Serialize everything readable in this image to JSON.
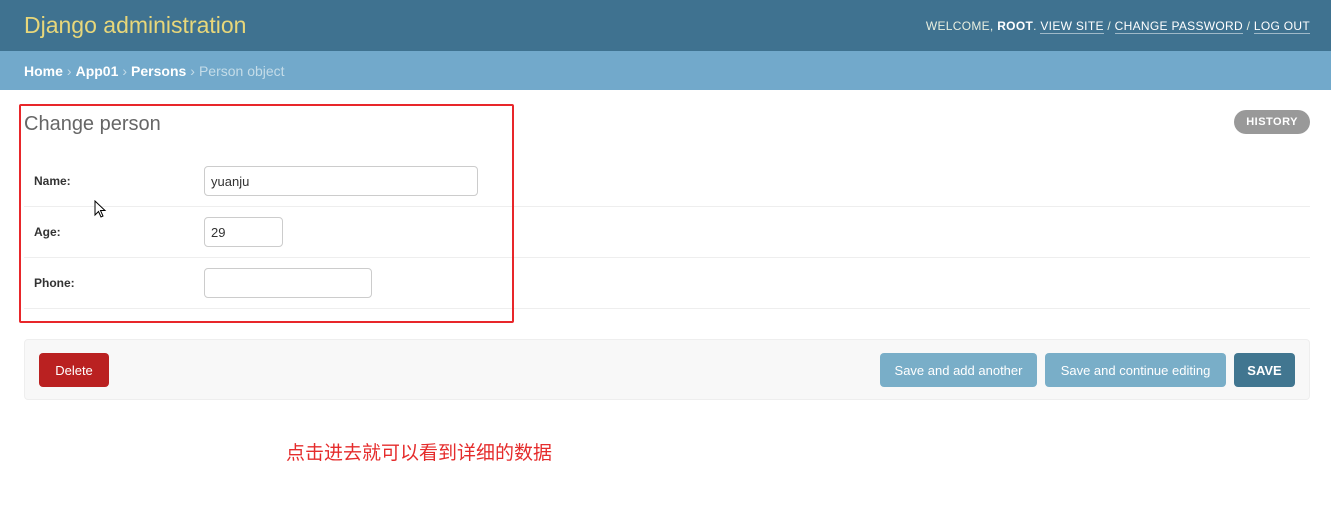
{
  "header": {
    "title": "Django administration",
    "welcome": "Welcome,",
    "user": "root",
    "view_site": "View site",
    "change_password": "Change password",
    "log_out": "Log out",
    "sep": "/"
  },
  "breadcrumbs": {
    "home": "Home",
    "app": "App01",
    "model": "Persons",
    "current": "Person object",
    "sep": "›"
  },
  "page": {
    "title": "Change person",
    "history": "HISTORY"
  },
  "form": {
    "fields": [
      {
        "label": "Name:",
        "value": "yuanju"
      },
      {
        "label": "Age:",
        "value": "29"
      },
      {
        "label": "Phone:",
        "value": ""
      }
    ]
  },
  "actions": {
    "delete": "Delete",
    "save_add": "Save and add another",
    "save_continue": "Save and continue editing",
    "save": "SAVE"
  },
  "annotation": {
    "text": "点击进去就可以看到详细的数据",
    "color": "#e52c2c"
  }
}
